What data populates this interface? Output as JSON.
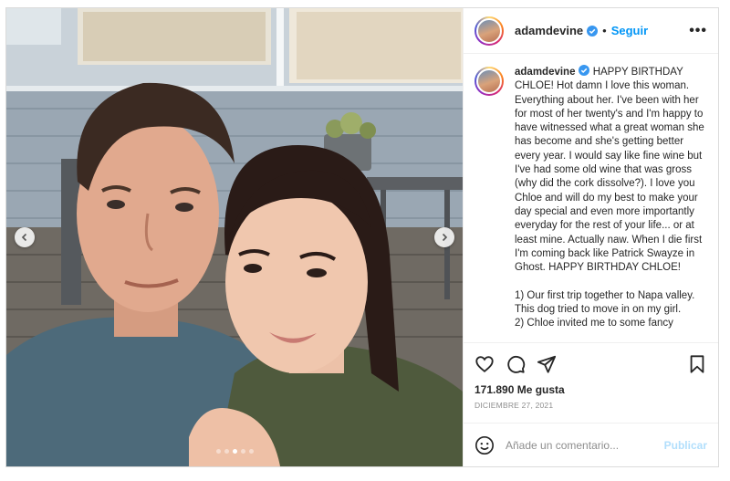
{
  "post": {
    "username": "adamdevine",
    "follow_label": "Seguir",
    "separator": "•",
    "more_label": "•••",
    "caption": "HAPPY BIRTHDAY CHLOE! Hot damn I love this woman. Everything about her. I've been with her for most of her twenty's and I'm happy to have witnessed what a great woman she has become and she's getting better every year. I would say like fine wine but I've had some old wine that was gross (why did the cork dissolve?). I love you Chloe and will do my best to make your day special and even more importantly everyday for the rest of your life... or at least mine. Actually naw. When I die first I'm coming back like Patrick Swayze in Ghost. HAPPY BIRTHDAY CHLOE!\n\n1) Our first trip together to Napa valley. This dog tried to move in on my girl.\n2) Chloe invited me to some fancy",
    "likes": "171.890 Me gusta",
    "date": "DICIEMBRE 27, 2021"
  },
  "comment": {
    "placeholder": "Añade un comentario...",
    "publish_label": "Publicar"
  },
  "carousel": {
    "slide_count": 5,
    "active_index": 2
  },
  "colors": {
    "link_blue": "#0095f6",
    "publish_disabled": "#b2dffc",
    "verified_blue": "#3897f0",
    "muted": "#8e8e8e"
  },
  "icons": [
    "chevron-left-icon",
    "chevron-right-icon",
    "verified-badge-icon",
    "heart-icon",
    "comment-icon",
    "share-icon",
    "bookmark-icon",
    "emoji-icon",
    "more-options-icon"
  ]
}
